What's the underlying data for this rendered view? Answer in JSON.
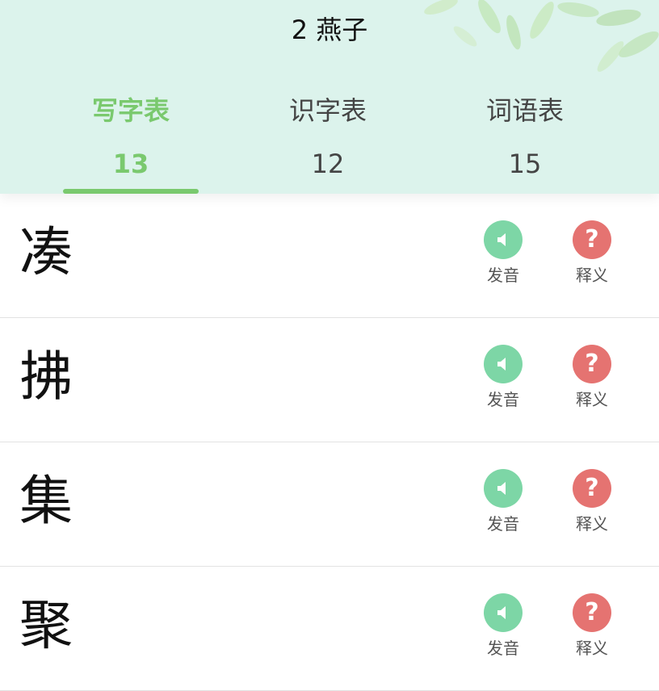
{
  "header": {
    "title": "2 燕子"
  },
  "tabs": [
    {
      "label": "写字表",
      "count": "13",
      "active": true
    },
    {
      "label": "识字表",
      "count": "12",
      "active": false
    },
    {
      "label": "词语表",
      "count": "15",
      "active": false
    }
  ],
  "actions": {
    "pronounce_label": "发音",
    "define_label": "释义",
    "pronounce_icon": "speaker-icon",
    "define_icon": "question-icon",
    "define_symbol": "?"
  },
  "characters": [
    {
      "char": "凑"
    },
    {
      "char": "拂"
    },
    {
      "char": "集"
    },
    {
      "char": "聚"
    }
  ],
  "colors": {
    "header_bg": "#dcf3ec",
    "accent_green": "#7ac96e",
    "play_green": "#7dd6a6",
    "define_red": "#e57371"
  }
}
